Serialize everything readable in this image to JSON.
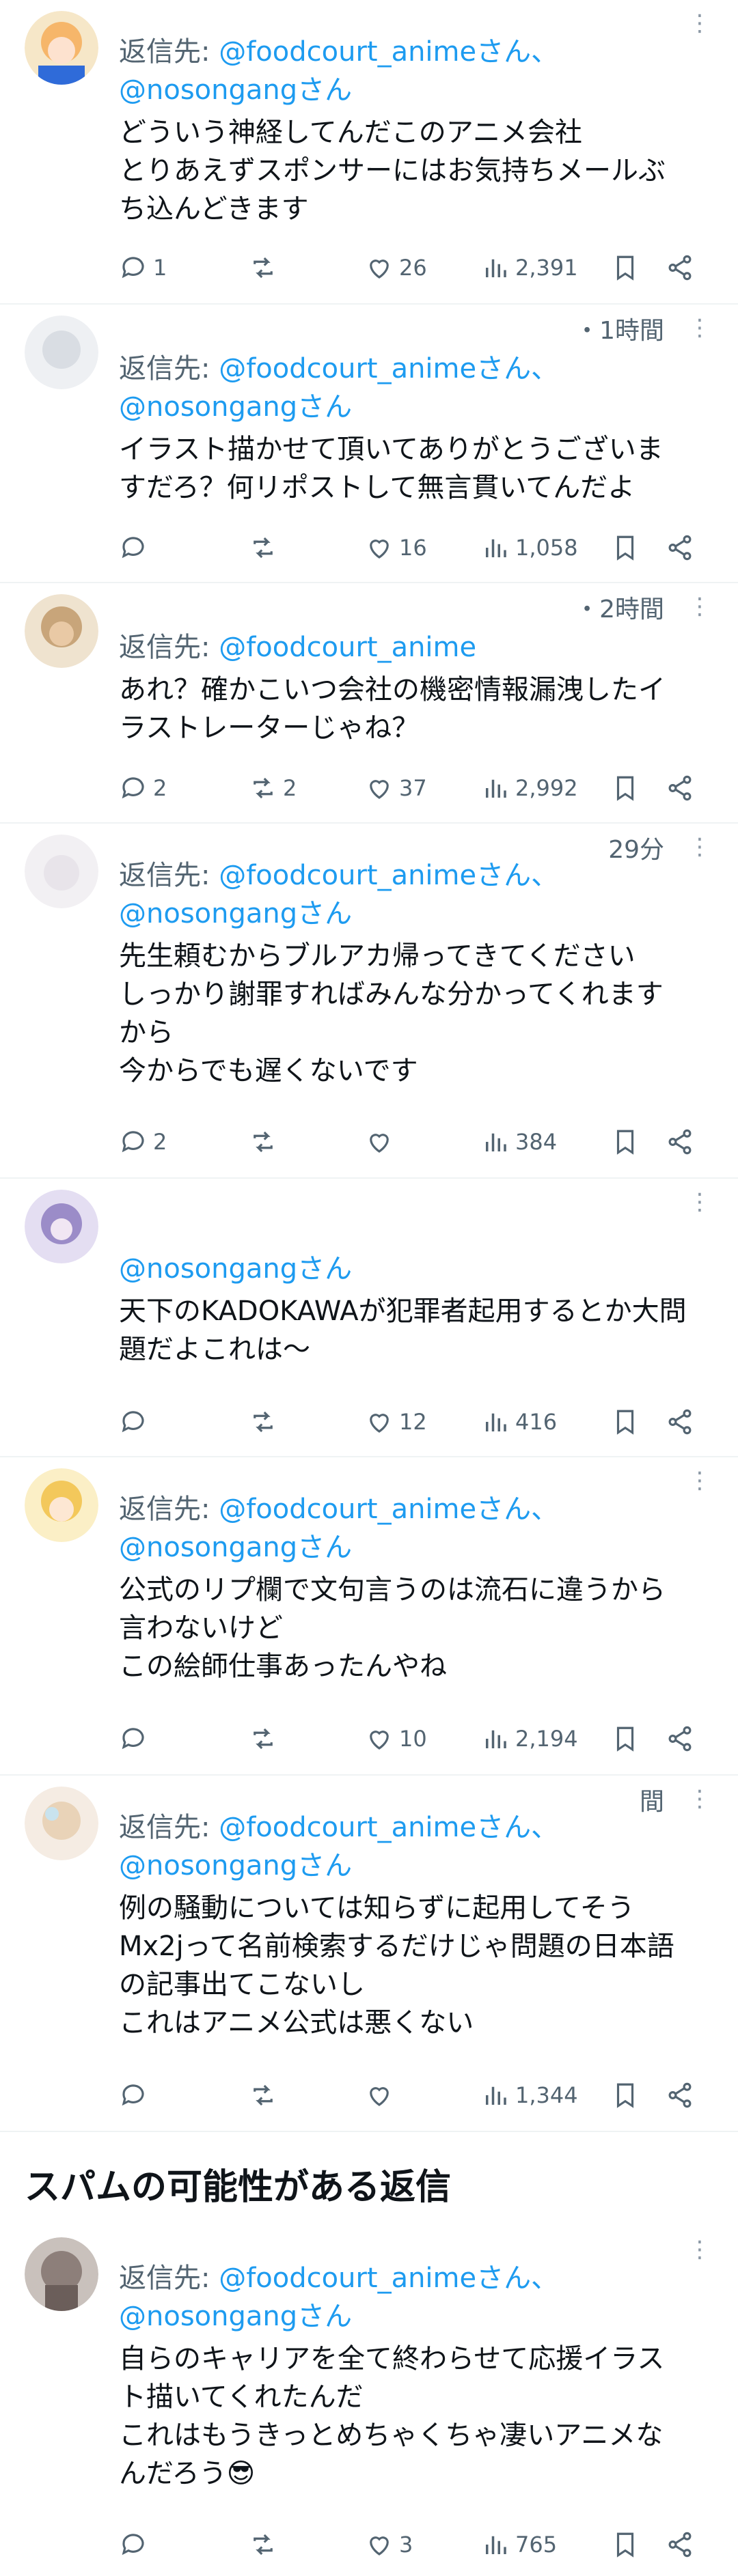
{
  "section_title": "スパムの可能性がある返信",
  "reply_prefix": "返信先: ",
  "reply_suffix": "さん、",
  "tweets": [
    {
      "meta": "",
      "reply_handle": "@foodcourt_anime",
      "second_handle": "@nosongangさん",
      "lines": [
        "どういう神経してんだこのアニメ会社",
        "とりあえずスポンサーにはお気持ちメールぶ",
        "ち込んどきます"
      ],
      "replies": "1",
      "retweets": "",
      "likes": "26",
      "views": "2,391",
      "avatar_color": "#f6b66a"
    },
    {
      "meta": "・1時間",
      "reply_handle": "@foodcourt_anime",
      "second_handle": "@nosongangさん",
      "lines": [
        "イラスト描かせて頂いてありがとうございま",
        "すだろ？何リポストして無言貫いてんだよ"
      ],
      "replies": "",
      "retweets": "",
      "likes": "16",
      "views": "1,058",
      "avatar_color": "#d9dde3"
    },
    {
      "meta": "・2時間",
      "reply_handle": "@foodcourt_anime",
      "second_handle": "",
      "lines": [
        "あれ？確かこいつ会社の機密情報漏洩したイ",
        "ラストレーターじゃね？"
      ],
      "replies": "2",
      "retweets": "2",
      "likes": "37",
      "views": "2,992",
      "avatar_color": "#c8a57a"
    },
    {
      "meta": "29分",
      "reply_handle": "@foodcourt_anime",
      "second_handle": "@nosongangさん",
      "lines": [
        "先生頼むからブルアカ帰ってきてください",
        "しっかり謝罪すればみんな分かってくれます",
        "から",
        "今からでも遅くないです"
      ],
      "replies": "2",
      "retweets": "",
      "likes": "",
      "views": "384",
      "avatar_color": "#e8e4ea"
    },
    {
      "meta": "",
      "reply_handle": "",
      "second_handle": "@nosongangさん",
      "lines": [
        "天下のKADOKAWAが犯罪者起用するとか大問",
        "題だよこれは〜"
      ],
      "replies": "",
      "retweets": "",
      "likes": "12",
      "views": "416",
      "avatar_color": "#9b8cc8"
    },
    {
      "meta": "",
      "reply_handle": "@foodcourt_anime",
      "second_handle": "@nosongangさん",
      "lines": [
        "公式のリプ欄で文句言うのは流石に違うから",
        "言わないけど",
        "この絵師仕事あったんやね"
      ],
      "replies": "",
      "retweets": "",
      "likes": "10",
      "views": "2,194",
      "avatar_color": "#f3c85b"
    },
    {
      "meta": "間",
      "reply_handle": "@foodcourt_anime",
      "second_handle": "@nosongangさん",
      "lines": [
        "例の騒動については知らずに起用してそう",
        "Mx2jって名前検索するだけじゃ問題の日本語",
        "の記事出てこないし",
        "これはアニメ公式は悪くない"
      ],
      "replies": "",
      "retweets": "",
      "likes": "",
      "views": "1,344",
      "avatar_color": "#e9d3b8"
    },
    {
      "meta": "",
      "reply_handle": "@foodcourt_anime",
      "second_handle": "@nosongangさん",
      "lines": [
        "自らのキャリアを全て終わらせて応援イラス",
        "ト描いてくれたんだ",
        "これはもうきっとめちゃくちゃ凄いアニメな",
        "んだろう😎"
      ],
      "replies": "",
      "retweets": "",
      "likes": "3",
      "views": "765",
      "avatar_color": "#8d7f7a"
    }
  ]
}
